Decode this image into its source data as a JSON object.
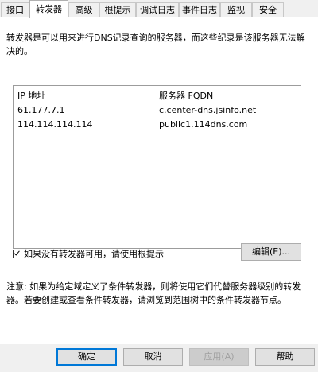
{
  "tabs": [
    {
      "label": "接口"
    },
    {
      "label": "转发器"
    },
    {
      "label": "高级"
    },
    {
      "label": "根提示"
    },
    {
      "label": "调试日志"
    },
    {
      "label": "事件日志"
    },
    {
      "label": "监视"
    },
    {
      "label": "安全"
    }
  ],
  "active_tab": "转发器",
  "description": "转发器是可以用来进行DNS记录查询的服务器，而这些纪录是该服务器无法解决的。",
  "forwarders": {
    "columns": [
      "IP 地址",
      "服务器 FQDN"
    ],
    "rows": [
      [
        "61.177.7.1",
        "c.center-dns.jsinfo.net"
      ],
      [
        "114.114.114.114",
        "public1.114dns.com"
      ]
    ]
  },
  "use_root_hints": {
    "label": "如果没有转发器可用，请使用根提示",
    "checked": true
  },
  "edit_button": "编辑(E)...",
  "note": "注意: 如果为给定域定义了条件转发器，则将使用它们代替服务器级别的转发器。若要创建或查看条件转发器，请浏览到范围树中的条件转发器节点。",
  "buttons": {
    "ok": "确定",
    "cancel": "取消",
    "apply": "应用(A)",
    "help": "帮助"
  }
}
